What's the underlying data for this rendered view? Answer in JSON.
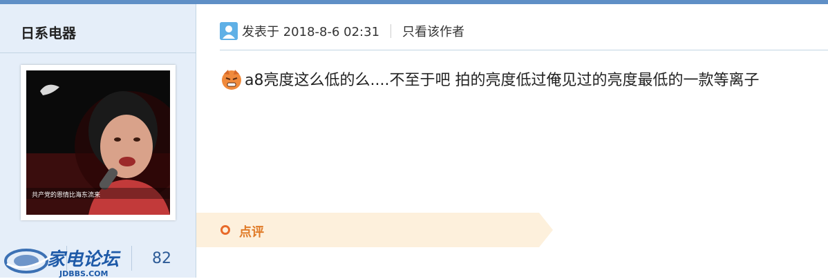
{
  "sidebar": {
    "username": "日系电器",
    "stats": {
      "right_value": "82"
    }
  },
  "watermark": {
    "brand": "家电论坛",
    "site": "JDBBS.COM"
  },
  "post": {
    "posted_at": "发表于 2018-8-6 02:31",
    "only_author": "只看该作者",
    "content": "a8亮度这么低的么....不至于吧 拍的亮度低过俺见过的亮度最低的一款等离子"
  },
  "comment": {
    "label": "点评"
  },
  "colors": {
    "accent": "#5f8fc6",
    "sidebar_bg": "#e5eef9",
    "comment_bg": "#fdf0dc",
    "comment_text": "#e07b28"
  }
}
